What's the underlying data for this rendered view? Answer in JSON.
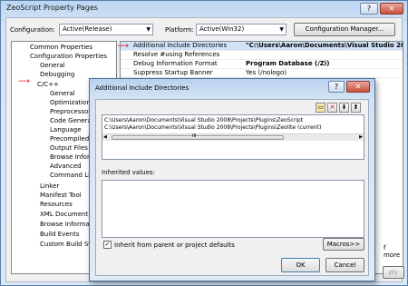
{
  "window": {
    "title": "ZeoScript Property Pages",
    "help_btn": "?",
    "close_btn": "✕"
  },
  "config_bar": {
    "configuration_label": "Configuration:",
    "configuration_value": "Active(Release)",
    "platform_label": "Platform:",
    "platform_value": "Active(Win32)",
    "config_manager_button": "Configuration Manager..."
  },
  "tree": {
    "items": [
      {
        "label": "Common Properties"
      },
      {
        "label": "Configuration Properties"
      },
      {
        "label": "General"
      },
      {
        "label": "Debugging"
      },
      {
        "label": "C/C++"
      },
      {
        "label": "General"
      },
      {
        "label": "Optimization"
      },
      {
        "label": "Preprocessor"
      },
      {
        "label": "Code Generation"
      },
      {
        "label": "Language"
      },
      {
        "label": "Precompiled Head"
      },
      {
        "label": "Output Files"
      },
      {
        "label": "Browse Informati"
      },
      {
        "label": "Advanced"
      },
      {
        "label": "Command Line"
      },
      {
        "label": "Linker"
      },
      {
        "label": "Manifest Tool"
      },
      {
        "label": "Resources"
      },
      {
        "label": "XML Document Gen"
      },
      {
        "label": "Browse Information"
      },
      {
        "label": "Build Events"
      },
      {
        "label": "Custom Build St"
      }
    ]
  },
  "grid": {
    "rows": [
      {
        "key": "Additional Include Directories",
        "value": "\"C:\\Users\\Aaron\\Documents\\Visual Studio 2008\\Proje"
      },
      {
        "key": "Resolve #using References",
        "value": ""
      },
      {
        "key": "Debug Information Format",
        "value": "Program Database (/Zi)"
      },
      {
        "key": "Suppress Startup Banner",
        "value": "Yes (/nologo)"
      }
    ]
  },
  "bottom": {
    "more_fragment": "f more",
    "apply_fragment": "ply"
  },
  "dialog": {
    "title": "Additional Include Directories",
    "help_btn": "?",
    "close_btn": "✕",
    "entries": [
      "C:\\Users\\Aaron\\Documents\\Visual Studio 2008\\Projects\\Plugins\\ZeoScript",
      "C:\\Users\\Aaron\\Documents\\Visual Studio 2008\\Projects\\Plugins\\Zeolite (current)"
    ],
    "scroll_grip": "III",
    "inherited_label": "Inherited values:",
    "inherit_checkbox_label": "Inherit from parent or project defaults",
    "inherit_checked": "✓",
    "macros_button": "Macros>>",
    "ok_button": "OK",
    "cancel_button": "Cancel"
  },
  "annotations": {
    "arrow": "⟶"
  }
}
